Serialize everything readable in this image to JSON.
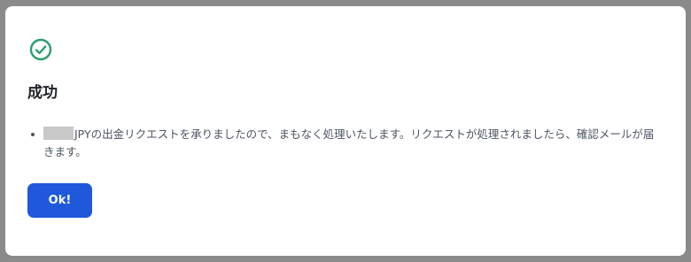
{
  "dialog": {
    "icon": "check-circle-icon",
    "title": "成功",
    "message": "JPYの出金リクエストを承りましたので、まもなく処理いたします。リクエストが処理されましたら、確認メールが届きます。",
    "ok_label": "Ok!"
  },
  "colors": {
    "success": "#2a9d6e",
    "primary": "#1f58db",
    "overlay": "#8a8a8a",
    "text": "#4d5563"
  }
}
